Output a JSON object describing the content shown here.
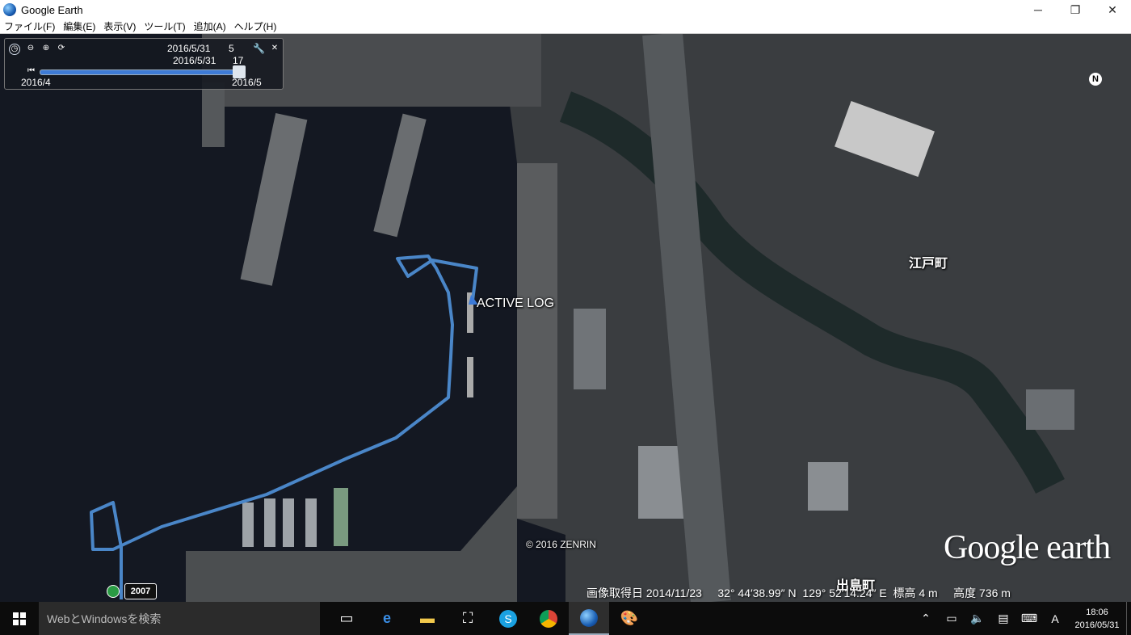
{
  "window": {
    "title": "Google Earth",
    "minimize": "─",
    "restore": "❐",
    "close": "✕"
  },
  "menu": [
    "ファイル(F)",
    "編集(E)",
    "表示(V)",
    "ツール(T)",
    "追加(A)",
    "ヘルプ(H)"
  ],
  "time_slider": {
    "current_date": "2016/5/31",
    "current_value": "5",
    "end_date": "2016/5/31",
    "end_value": "17",
    "range_start": "2016/4",
    "range_end": "2016/5",
    "icons": [
      "clock-icon",
      "zoom-out-icon",
      "zoom-in-icon",
      "refresh-icon",
      "wrench-icon",
      "close-icon"
    ]
  },
  "map": {
    "placemark_label": "ACTIVE LOG",
    "place_labels": {
      "edomachi": "江戸町",
      "dejima": "出島町"
    },
    "copyright": "© 2016 ZENRIN",
    "logo": "Google earth",
    "historical_year": "2007",
    "compass_letter": "N",
    "track_color": "#4a86c8"
  },
  "status": {
    "imagery_date": "画像取得日 2014/11/23",
    "latitude": "32° 44′38.99″ N",
    "longitude": "129° 52′14.24″ E",
    "elevation": "標高  4 m",
    "altitude": "高度  736 m"
  },
  "taskbar": {
    "search_placeholder": "WebとWindowsを検索",
    "apps": [
      "task-view-icon",
      "edge-icon",
      "file-explorer-icon",
      "store-icon",
      "skype-icon",
      "chrome-icon",
      "google-earth-icon",
      "paint-icon"
    ],
    "ime": "A",
    "time": "18:06",
    "date": "2016/05/31"
  }
}
